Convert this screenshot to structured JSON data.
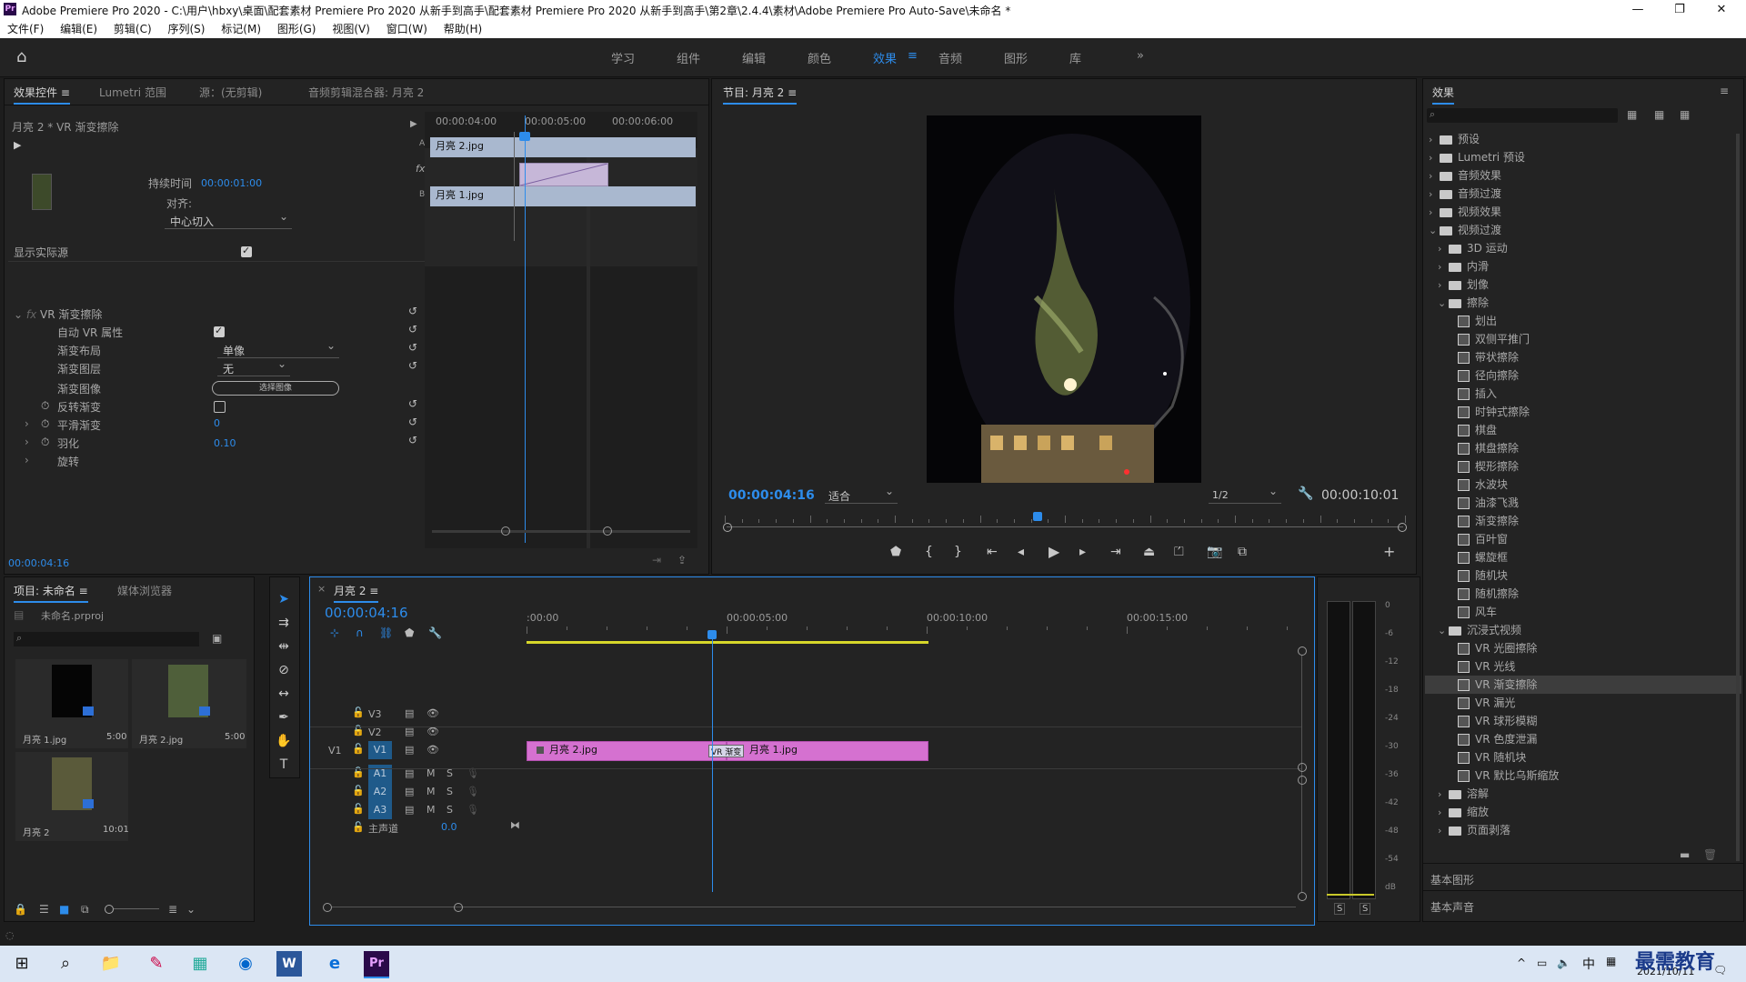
{
  "window": {
    "title": "Adobe Premiere Pro 2020 - C:\\用户\\hbxy\\桌面\\配套素材 Premiere Pro 2020 从新手到高手\\配套素材 Premiere Pro 2020 从新手到高手\\第2章\\2.4.4\\素材\\Adobe Premiere Pro Auto-Save\\未命名 *",
    "logo": "Pr",
    "minimize": "—",
    "maximize": "❐",
    "close": "✕"
  },
  "menu": [
    "文件(F)",
    "编辑(E)",
    "剪辑(C)",
    "序列(S)",
    "标记(M)",
    "图形(G)",
    "视图(V)",
    "窗口(W)",
    "帮助(H)"
  ],
  "workspaces": {
    "tabs": [
      "学习",
      "组件",
      "编辑",
      "颜色",
      "效果",
      "音频",
      "图形",
      "库"
    ],
    "active": "效果",
    "more": "»"
  },
  "effect_controls": {
    "tabs": [
      "效果控件",
      "Lumetri 范围",
      "源：(无剪辑)",
      "音频剪辑混合器: 月亮 2"
    ],
    "clip_path": "月亮 2 * VR 渐变擦除",
    "ruler": [
      "00:00:04:00",
      "00:00:05:00",
      "00:00:06:00"
    ],
    "clip_a": "月亮 2.jpg",
    "clip_b": "月亮 1.jpg",
    "track_a": "A",
    "track_b": "B",
    "duration_label": "持续时间",
    "duration_value": "00:00:01:00",
    "align_label": "对齐:",
    "align_value": "中心切入",
    "show_actual_sources": "显示实际源",
    "show_actual_sources_checked": true,
    "effect_name": "VR 渐变擦除",
    "props": {
      "auto_vr": "自动 VR 属性",
      "layout_label": "渐变布局",
      "layout_value": "单像",
      "layer_label": "渐变图层",
      "layer_value": "无",
      "image_label": "渐变图像",
      "image_button": "选择图像",
      "invert_label": "反转渐变",
      "smooth_label": "平滑渐变",
      "smooth_value": "0",
      "feather_label": "羽化",
      "feather_value": "0.10",
      "rotation_label": "旋转"
    },
    "current_time": "00:00:04:16"
  },
  "program_monitor": {
    "title": "节目: 月亮 2",
    "timecode": "00:00:04:16",
    "fit": "适合",
    "resolution": "1/2",
    "duration": "00:00:10:01",
    "playhead_fraction": 0.46
  },
  "effects_panel": {
    "title": "效果",
    "tree": [
      {
        "label": "预设",
        "type": "folder",
        "depth": 0,
        "open": false
      },
      {
        "label": "Lumetri 预设",
        "type": "folder",
        "depth": 0,
        "open": false
      },
      {
        "label": "音频效果",
        "type": "folder",
        "depth": 0,
        "open": false
      },
      {
        "label": "音频过渡",
        "type": "folder",
        "depth": 0,
        "open": false
      },
      {
        "label": "视频效果",
        "type": "folder",
        "depth": 0,
        "open": false
      },
      {
        "label": "视频过渡",
        "type": "folder",
        "depth": 0,
        "open": true
      },
      {
        "label": "3D 运动",
        "type": "folder",
        "depth": 1,
        "open": false
      },
      {
        "label": "内滑",
        "type": "folder",
        "depth": 1,
        "open": false
      },
      {
        "label": "划像",
        "type": "folder",
        "depth": 1,
        "open": false
      },
      {
        "label": "擦除",
        "type": "folder",
        "depth": 1,
        "open": true
      },
      {
        "label": "划出",
        "type": "fx",
        "depth": 2
      },
      {
        "label": "双侧平推门",
        "type": "fx",
        "depth": 2
      },
      {
        "label": "带状擦除",
        "type": "fx",
        "depth": 2
      },
      {
        "label": "径向擦除",
        "type": "fx",
        "depth": 2
      },
      {
        "label": "插入",
        "type": "fx",
        "depth": 2
      },
      {
        "label": "时钟式擦除",
        "type": "fx",
        "depth": 2
      },
      {
        "label": "棋盘",
        "type": "fx",
        "depth": 2
      },
      {
        "label": "棋盘擦除",
        "type": "fx",
        "depth": 2
      },
      {
        "label": "楔形擦除",
        "type": "fx",
        "depth": 2
      },
      {
        "label": "水波块",
        "type": "fx",
        "depth": 2
      },
      {
        "label": "油漆飞溅",
        "type": "fx",
        "depth": 2
      },
      {
        "label": "渐变擦除",
        "type": "fx",
        "depth": 2
      },
      {
        "label": "百叶窗",
        "type": "fx",
        "depth": 2
      },
      {
        "label": "螺旋框",
        "type": "fx",
        "depth": 2
      },
      {
        "label": "随机块",
        "type": "fx",
        "depth": 2
      },
      {
        "label": "随机擦除",
        "type": "fx",
        "depth": 2
      },
      {
        "label": "风车",
        "type": "fx",
        "depth": 2
      },
      {
        "label": "沉浸式视频",
        "type": "folder",
        "depth": 1,
        "open": true
      },
      {
        "label": "VR 光圈擦除",
        "type": "fx",
        "depth": 2
      },
      {
        "label": "VR 光线",
        "type": "fx",
        "depth": 2
      },
      {
        "label": "VR 渐变擦除",
        "type": "fx",
        "depth": 2,
        "selected": true
      },
      {
        "label": "VR 漏光",
        "type": "fx",
        "depth": 2
      },
      {
        "label": "VR 球形模糊",
        "type": "fx",
        "depth": 2
      },
      {
        "label": "VR 色度泄漏",
        "type": "fx",
        "depth": 2
      },
      {
        "label": "VR 随机块",
        "type": "fx",
        "depth": 2
      },
      {
        "label": "VR 默比乌斯缩放",
        "type": "fx",
        "depth": 2
      },
      {
        "label": "溶解",
        "type": "folder",
        "depth": 1,
        "open": false
      },
      {
        "label": "缩放",
        "type": "folder",
        "depth": 1,
        "open": false
      },
      {
        "label": "页面剥落",
        "type": "folder",
        "depth": 1,
        "open": false
      }
    ],
    "basic_graphics": "基本图形",
    "basic_sound": "基本声音"
  },
  "project_panel": {
    "tabs": [
      "项目: 未命名",
      "媒体浏览器"
    ],
    "file": "未命名.prproj",
    "items": [
      {
        "name": "月亮 1.jpg",
        "duration": "5:00"
      },
      {
        "name": "月亮 2.jpg",
        "duration": "5:00"
      },
      {
        "name": "月亮 2",
        "duration": "10:01"
      }
    ]
  },
  "timeline": {
    "tab": "月亮 2",
    "timecode": "00:00:04:16",
    "ruler": [
      ":00:00",
      "00:00:05:00",
      "00:00:10:00",
      "00:00:15:00"
    ],
    "tracks": [
      "V3",
      "V2",
      "V1",
      "A1",
      "A2",
      "A3"
    ],
    "source_v": "V1",
    "master_label": "主声道",
    "master_value": "0.0",
    "clips": [
      {
        "name": "月亮 2.jpg",
        "start": 0,
        "end": 5
      },
      {
        "name": "月亮 1.jpg",
        "start": 5,
        "end": 10.04
      }
    ],
    "transition": "VR 渐变",
    "playhead_seconds": 4.64,
    "mute_label": "M",
    "solo_label": "S"
  },
  "audio_meter": {
    "scale": [
      "0",
      "-6",
      "-12",
      "-18",
      "-24",
      "-30",
      "-36",
      "-42",
      "-48",
      "-54",
      "dB"
    ],
    "solo_left": "S",
    "solo_right": "S"
  },
  "taskbar": {
    "time": "",
    "date": "2021/10/11",
    "ime": "中",
    "watermark": "最需教育"
  }
}
